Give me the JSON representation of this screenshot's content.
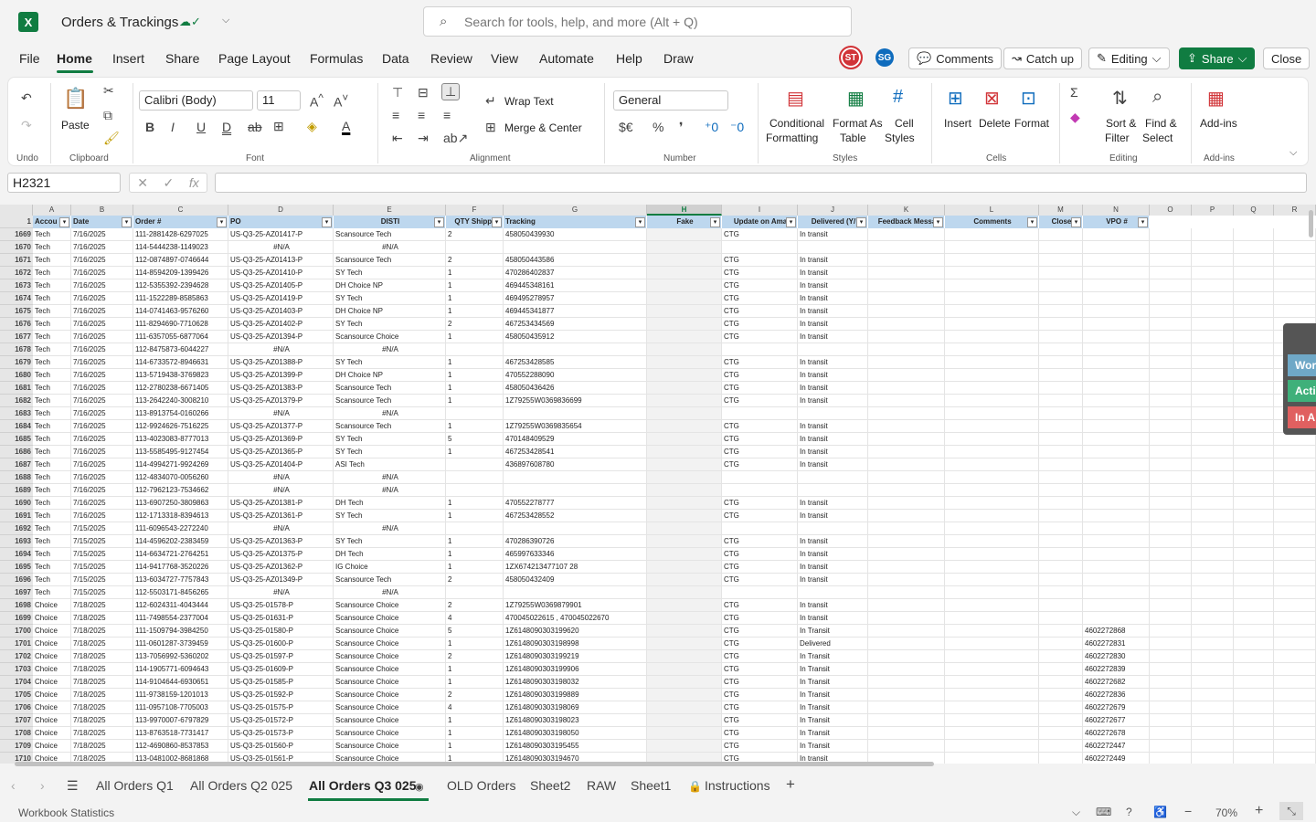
{
  "app": {
    "title": "Orders & Trackings",
    "search_placeholder": "Search for tools, help, and more (Alt + Q)",
    "icons": [
      "excel-logo",
      "cloud-saved-icon",
      "search-icon"
    ]
  },
  "menu": {
    "items": [
      "File",
      "Home",
      "Insert",
      "Share",
      "Page Layout",
      "Formulas",
      "Data",
      "Review",
      "View",
      "Automate",
      "Help",
      "Draw"
    ],
    "active": "Home"
  },
  "header": {
    "avatars": [
      "ST",
      "SG"
    ],
    "comments": "Comments",
    "catchup": "Catch up",
    "editing": "Editing",
    "share": "Share",
    "close": "Close"
  },
  "ribbon": {
    "undo": "Undo",
    "clipboard": "Clipboard",
    "paste": "Paste",
    "font": "Font",
    "font_name": "Calibri (Body)",
    "font_size": "11",
    "alignment": "Alignment",
    "wrap": "Wrap Text",
    "merge": "Merge & Center",
    "number": "Number",
    "number_format": "General",
    "styles": "Styles",
    "cond": "Conditional",
    "cond2": "Formatting",
    "fmt_table": "Format As",
    "fmt_table2": "Table",
    "cell_styles": "Cell",
    "cell_styles2": "Styles",
    "cells": "Cells",
    "insert": "Insert",
    "delete": "Delete",
    "format": "Format",
    "editing": "Editing",
    "sort": "Sort &",
    "sort2": "Filter",
    "find": "Find &",
    "find2": "Select",
    "addins": "Add-ins",
    "addins_grp": "Add-ins"
  },
  "formula": {
    "namebox": "H2321",
    "value": ""
  },
  "columns": [
    "A",
    "B",
    "C",
    "D",
    "E",
    "F",
    "G",
    "H",
    "I",
    "J",
    "K",
    "L",
    "M",
    "N",
    "O",
    "P",
    "Q",
    "R"
  ],
  "table_headers": [
    "Accou",
    "Date",
    "Order #",
    "PO",
    "DISTI",
    "QTY Shippe",
    "Tracking",
    "Fake",
    "Update on Ama",
    "Delivered (Y/",
    "Feedback Messa",
    "Comments",
    "Close",
    "VPO #"
  ],
  "rows": [
    [
      "1669",
      "Tech",
      "7/16/2025",
      "111-2881428-6297025",
      "US-Q3-25-AZ01417-P",
      "Scansource Tech",
      "2",
      "458050439930",
      "",
      "CTG",
      "In transit",
      ""
    ],
    [
      "1670",
      "Tech",
      "7/16/2025",
      "114-5444238-1149023",
      "#N/A",
      "#N/A",
      "",
      "",
      "",
      "",
      "",
      ""
    ],
    [
      "1671",
      "Tech",
      "7/16/2025",
      "112-0874897-0746644",
      "US-Q3-25-AZ01413-P",
      "Scansource Tech",
      "2",
      "458050443586",
      "",
      "CTG",
      "In transit",
      ""
    ],
    [
      "1672",
      "Tech",
      "7/16/2025",
      "114-8594209-1399426",
      "US-Q3-25-AZ01410-P",
      "SY Tech",
      "1",
      "470286402837",
      "",
      "CTG",
      "In transit",
      ""
    ],
    [
      "1673",
      "Tech",
      "7/16/2025",
      "112-5355392-2394628",
      "US-Q3-25-AZ01405-P",
      "DH Choice NP",
      "1",
      "469445348161",
      "",
      "CTG",
      "In transit",
      ""
    ],
    [
      "1674",
      "Tech",
      "7/16/2025",
      "111-1522289-8585863",
      "US-Q3-25-AZ01419-P",
      "SY Tech",
      "1",
      "469495278957",
      "",
      "CTG",
      "In transit",
      ""
    ],
    [
      "1675",
      "Tech",
      "7/16/2025",
      "114-0741463-9576260",
      "US-Q3-25-AZ01403-P",
      "DH Choice NP",
      "1",
      "469445341877",
      "",
      "CTG",
      "In transit",
      ""
    ],
    [
      "1676",
      "Tech",
      "7/16/2025",
      "111-8294690-7710628",
      "US-Q3-25-AZ01402-P",
      "SY Tech",
      "2",
      "467253434569",
      "",
      "CTG",
      "In transit",
      ""
    ],
    [
      "1677",
      "Tech",
      "7/16/2025",
      "111-6357055-6877064",
      "US-Q3-25-AZ01394-P",
      "Scansource Choice",
      "1",
      "458050435912",
      "",
      "CTG",
      "In transit",
      ""
    ],
    [
      "1678",
      "Tech",
      "7/16/2025",
      "112-8475873-6044227",
      "#N/A",
      "#N/A",
      "",
      "",
      "",
      "",
      "",
      ""
    ],
    [
      "1679",
      "Tech",
      "7/16/2025",
      "114-6733572-8946631",
      "US-Q3-25-AZ01388-P",
      "SY Tech",
      "1",
      "467253428585",
      "",
      "CTG",
      "In transit",
      ""
    ],
    [
      "1680",
      "Tech",
      "7/16/2025",
      "113-5719438-3769823",
      "US-Q3-25-AZ01399-P",
      "DH Choice NP",
      "1",
      "470552288090",
      "",
      "CTG",
      "In transit",
      ""
    ],
    [
      "1681",
      "Tech",
      "7/16/2025",
      "112-2780238-6671405",
      "US-Q3-25-AZ01383-P",
      "Scansource Tech",
      "1",
      "458050436426",
      "",
      "CTG",
      "In transit",
      ""
    ],
    [
      "1682",
      "Tech",
      "7/16/2025",
      "113-2642240-3008210",
      "US-Q3-25-AZ01379-P",
      "Scansource Tech",
      "1",
      "1Z79255W0369836699",
      "",
      "CTG",
      "In transit",
      ""
    ],
    [
      "1683",
      "Tech",
      "7/16/2025",
      "113-8913754-0160266",
      "#N/A",
      "#N/A",
      "",
      "",
      "",
      "",
      "",
      ""
    ],
    [
      "1684",
      "Tech",
      "7/16/2025",
      "112-9924626-7516225",
      "US-Q3-25-AZ01377-P",
      "Scansource Tech",
      "1",
      "1Z79255W0369835654",
      "",
      "CTG",
      "In transit",
      ""
    ],
    [
      "1685",
      "Tech",
      "7/16/2025",
      "113-4023083-8777013",
      "US-Q3-25-AZ01369-P",
      "SY Tech",
      "5",
      "470148409529",
      "",
      "CTG",
      "In transit",
      ""
    ],
    [
      "1686",
      "Tech",
      "7/16/2025",
      "113-5585495-9127454",
      "US-Q3-25-AZ01365-P",
      "SY Tech",
      "1",
      "467253428541",
      "",
      "CTG",
      "In transit",
      ""
    ],
    [
      "1687",
      "Tech",
      "7/16/2025",
      "114-4994271-9924269",
      "US-Q3-25-AZ01404-P",
      "ASI Tech",
      "",
      "436897608780",
      "",
      "CTG",
      "In transit",
      ""
    ],
    [
      "1688",
      "Tech",
      "7/16/2025",
      "112-4834070-0056260",
      "#N/A",
      "#N/A",
      "",
      "",
      "",
      "",
      "",
      ""
    ],
    [
      "1689",
      "Tech",
      "7/16/2025",
      "112-7962123-7534662",
      "#N/A",
      "#N/A",
      "",
      "",
      "",
      "",
      "",
      ""
    ],
    [
      "1690",
      "Tech",
      "7/16/2025",
      "113-6907250-3809863",
      "US-Q3-25-AZ01381-P",
      "DH Tech",
      "1",
      "470552278777",
      "",
      "CTG",
      "In transit",
      ""
    ],
    [
      "1691",
      "Tech",
      "7/16/2025",
      "112-1713318-8394613",
      "US-Q3-25-AZ01361-P",
      "SY Tech",
      "1",
      "467253428552",
      "",
      "CTG",
      "In transit",
      ""
    ],
    [
      "1692",
      "Tech",
      "7/15/2025",
      "111-6096543-2272240",
      "#N/A",
      "#N/A",
      "",
      "",
      "",
      "",
      "",
      ""
    ],
    [
      "1693",
      "Tech",
      "7/15/2025",
      "114-4596202-2383459",
      "US-Q3-25-AZ01363-P",
      "SY Tech",
      "1",
      "470286390726",
      "",
      "CTG",
      "In transit",
      ""
    ],
    [
      "1694",
      "Tech",
      "7/15/2025",
      "114-6634721-2764251",
      "US-Q3-25-AZ01375-P",
      "DH Tech",
      "1",
      "465997633346",
      "",
      "CTG",
      "In transit",
      ""
    ],
    [
      "1695",
      "Tech",
      "7/15/2025",
      "114-9417768-3520226",
      "US-Q3-25-AZ01362-P",
      "IG Choice",
      "1",
      "1ZX674213477107 28",
      "",
      "CTG",
      "In transit",
      ""
    ],
    [
      "1696",
      "Tech",
      "7/15/2025",
      "113-6034727-7757843",
      "US-Q3-25-AZ01349-P",
      "Scansource Tech",
      "2",
      "458050432409",
      "",
      "CTG",
      "In transit",
      ""
    ],
    [
      "1697",
      "Tech",
      "7/15/2025",
      "112-5503171-8456265",
      "#N/A",
      "#N/A",
      "",
      "",
      "",
      "",
      "",
      ""
    ],
    [
      "1698",
      "Choice",
      "7/18/2025",
      "112-6024311-4043444",
      "US-Q3-25-01578-P",
      "Scansource Choice",
      "2",
      "1Z79255W0369879901",
      "",
      "CTG",
      "In transit",
      ""
    ],
    [
      "1699",
      "Choice",
      "7/18/2025",
      "111-7498554-2377004",
      "US-Q3-25-01631-P",
      "Scansource Choice",
      "4",
      "470045022615 , 470045022670",
      "",
      "CTG",
      "In transit",
      ""
    ],
    [
      "1700",
      "Choice",
      "7/18/2025",
      "111-1509794-3984250",
      "US-Q3-25-01580-P",
      "Scansource Choice",
      "5",
      "1Z6148090303199620",
      "",
      "CTG",
      "In Transit",
      "4602272868"
    ],
    [
      "1701",
      "Choice",
      "7/18/2025",
      "111-0601287-3739459",
      "US-Q3-25-01600-P",
      "Scansource Choice",
      "1",
      "1Z6148090303198998",
      "",
      "CTG",
      "Delivered",
      "4602272831"
    ],
    [
      "1702",
      "Choice",
      "7/18/2025",
      "113-7056992-5360202",
      "US-Q3-25-01597-P",
      "Scansource Choice",
      "2",
      "1Z6148090303199219",
      "",
      "CTG",
      "In Transit",
      "4602272830"
    ],
    [
      "1703",
      "Choice",
      "7/18/2025",
      "114-1905771-6094643",
      "US-Q3-25-01609-P",
      "Scansource Choice",
      "1",
      "1Z6148090303199906",
      "",
      "CTG",
      "In Transit",
      "4602272839"
    ],
    [
      "1704",
      "Choice",
      "7/18/2025",
      "114-9104644-6930651",
      "US-Q3-25-01585-P",
      "Scansource Choice",
      "1",
      "1Z6148090303198032",
      "",
      "CTG",
      "In Transit",
      "4602272682"
    ],
    [
      "1705",
      "Choice",
      "7/18/2025",
      "111-9738159-1201013",
      "US-Q3-25-01592-P",
      "Scansource Choice",
      "2",
      "1Z6148090303199889",
      "",
      "CTG",
      "In Transit",
      "4602272836"
    ],
    [
      "1706",
      "Choice",
      "7/18/2025",
      "111-0957108-7705003",
      "US-Q3-25-01575-P",
      "Scansource Choice",
      "4",
      "1Z6148090303198069",
      "",
      "CTG",
      "In Transit",
      "4602272679"
    ],
    [
      "1707",
      "Choice",
      "7/18/2025",
      "113-9970007-6797829",
      "US-Q3-25-01572-P",
      "Scansource Choice",
      "1",
      "1Z6148090303198023",
      "",
      "CTG",
      "In Transit",
      "4602272677"
    ],
    [
      "1708",
      "Choice",
      "7/18/2025",
      "113-8763518-7731417",
      "US-Q3-25-01573-P",
      "Scansource Choice",
      "1",
      "1Z6148090303198050",
      "",
      "CTG",
      "In Transit",
      "4602272678"
    ],
    [
      "1709",
      "Choice",
      "7/18/2025",
      "112-4690860-8537853",
      "US-Q3-25-01560-P",
      "Scansource Choice",
      "1",
      "1Z6148090303195455",
      "",
      "CTG",
      "In Transit",
      "4602272447"
    ],
    [
      "1710",
      "Choice",
      "7/18/2025",
      "113-0481002-8681868",
      "US-Q3-25-01561-P",
      "Scansource Choice",
      "1",
      "1Z6148090303194670",
      "",
      "CTG",
      "In transit",
      "4602272449"
    ]
  ],
  "sheets": [
    "All Orders Q1",
    "All Orders Q2 025",
    "All Orders Q3 025",
    "OLD Orders",
    "Sheet2",
    "RAW",
    "Sheet1",
    "Instructions"
  ],
  "active_sheet": "All Orders Q3 025",
  "side_panel": [
    "Wor",
    "Acti",
    "In A"
  ],
  "status": {
    "left": "Workbook Statistics",
    "zoom": "70%"
  }
}
